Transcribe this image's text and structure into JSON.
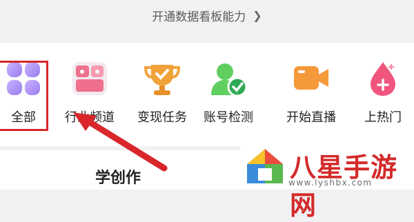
{
  "banner": {
    "text": "开通数据看板能力",
    "chevron": "chevron-right-icon"
  },
  "tools": [
    {
      "label": "全部",
      "icon": "all-grid-icon"
    },
    {
      "label": "行业频道",
      "icon": "industry-channel-icon"
    },
    {
      "label": "变现任务",
      "icon": "trophy-icon"
    },
    {
      "label": "账号检测",
      "icon": "account-check-icon"
    },
    {
      "label": "开始直播",
      "icon": "live-camera-icon"
    },
    {
      "label": "上热门",
      "icon": "hot-drop-icon"
    }
  ],
  "section": {
    "title": "学创作"
  },
  "watermark": {
    "text": "八星手游网",
    "url": "www.lyshbx.com"
  },
  "colors": {
    "highlight": "#d8262b",
    "arrow": "#d8262b"
  }
}
